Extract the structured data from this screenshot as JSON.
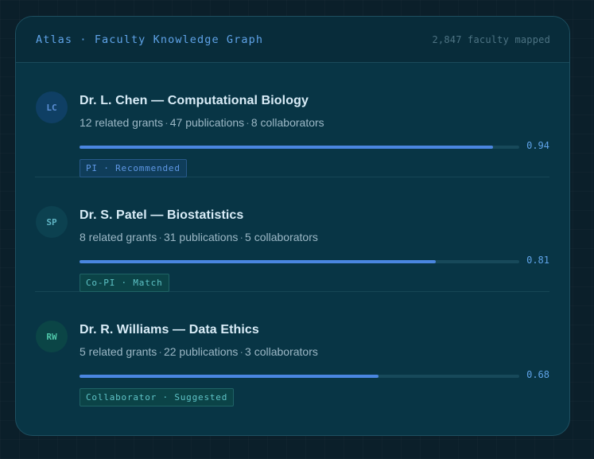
{
  "header": {
    "title": "Atlas · Faculty Knowledge Graph",
    "count_text": "2,847 faculty mapped"
  },
  "colors": {
    "accent": "#4a86e0",
    "panel": "#083545",
    "avatar_lc": "#0f3f64",
    "avatar_sp": "#0c4150",
    "avatar_rw": "#0b4546"
  },
  "faculty": [
    {
      "initials": "LC",
      "name": "Dr. L. Chen — Computational Biology",
      "grants": "12 related grants",
      "publications": "47 publications",
      "collaborators": "8 collaborators",
      "score": 0.94,
      "score_text": "0.94",
      "tag": "PI · Recommended"
    },
    {
      "initials": "SP",
      "name": "Dr. S. Patel — Biostatistics",
      "grants": "8 related grants",
      "publications": "31 publications",
      "collaborators": "5 collaborators",
      "score": 0.81,
      "score_text": "0.81",
      "tag": "Co-PI · Match"
    },
    {
      "initials": "RW",
      "name": "Dr. R. Williams — Data Ethics",
      "grants": "5 related grants",
      "publications": "22 publications",
      "collaborators": "3 collaborators",
      "score": 0.68,
      "score_text": "0.68",
      "tag": "Collaborator · Suggested"
    }
  ],
  "separator": "·"
}
